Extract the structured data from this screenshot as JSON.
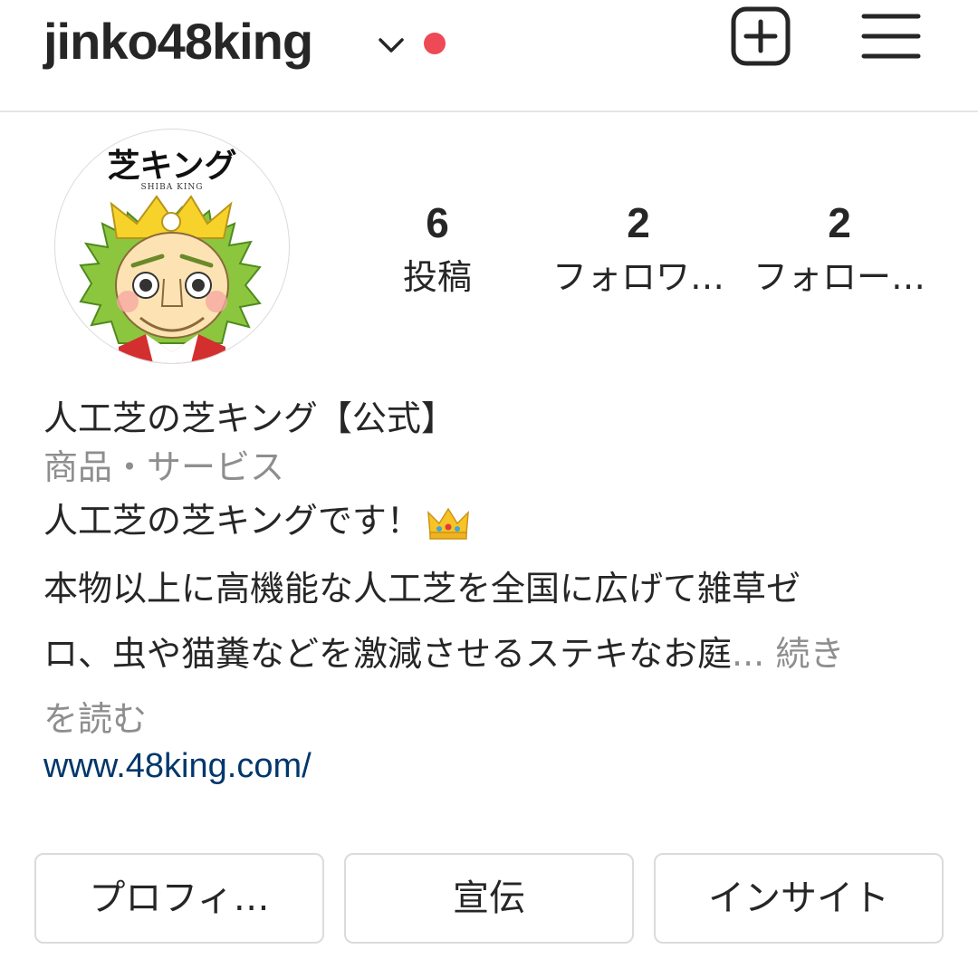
{
  "header": {
    "username": "jinko48king",
    "has_notification": true,
    "notification_color": "#ed4956",
    "icons": [
      "chevron-down-icon",
      "new-post-icon",
      "menu-icon"
    ]
  },
  "profile": {
    "avatar_icon": "shiba-king-logo",
    "stats": [
      {
        "value": "6",
        "label": "投稿"
      },
      {
        "value": "2",
        "label": "フォロワ…"
      },
      {
        "value": "2",
        "label": "フォロー…"
      }
    ]
  },
  "bio": {
    "name": "人工芝の芝キング【公式】",
    "category": "商品・サービス",
    "line1": "人工芝の芝キングです！",
    "desc_line1": "本物以上に高機能な人工芝を全国に広げて雑草ゼ",
    "desc_line2": "ロ、虫や猫糞などを激減させるステキなお庭",
    "ellipsis": "...",
    "more_part1": " 続き",
    "more_part2": "を読む",
    "link": "www.48king.com/",
    "link_color": "#00376b"
  },
  "buttons": {
    "edit_profile": "プロフィ…",
    "promote": "宣伝",
    "insights": "インサイト"
  }
}
